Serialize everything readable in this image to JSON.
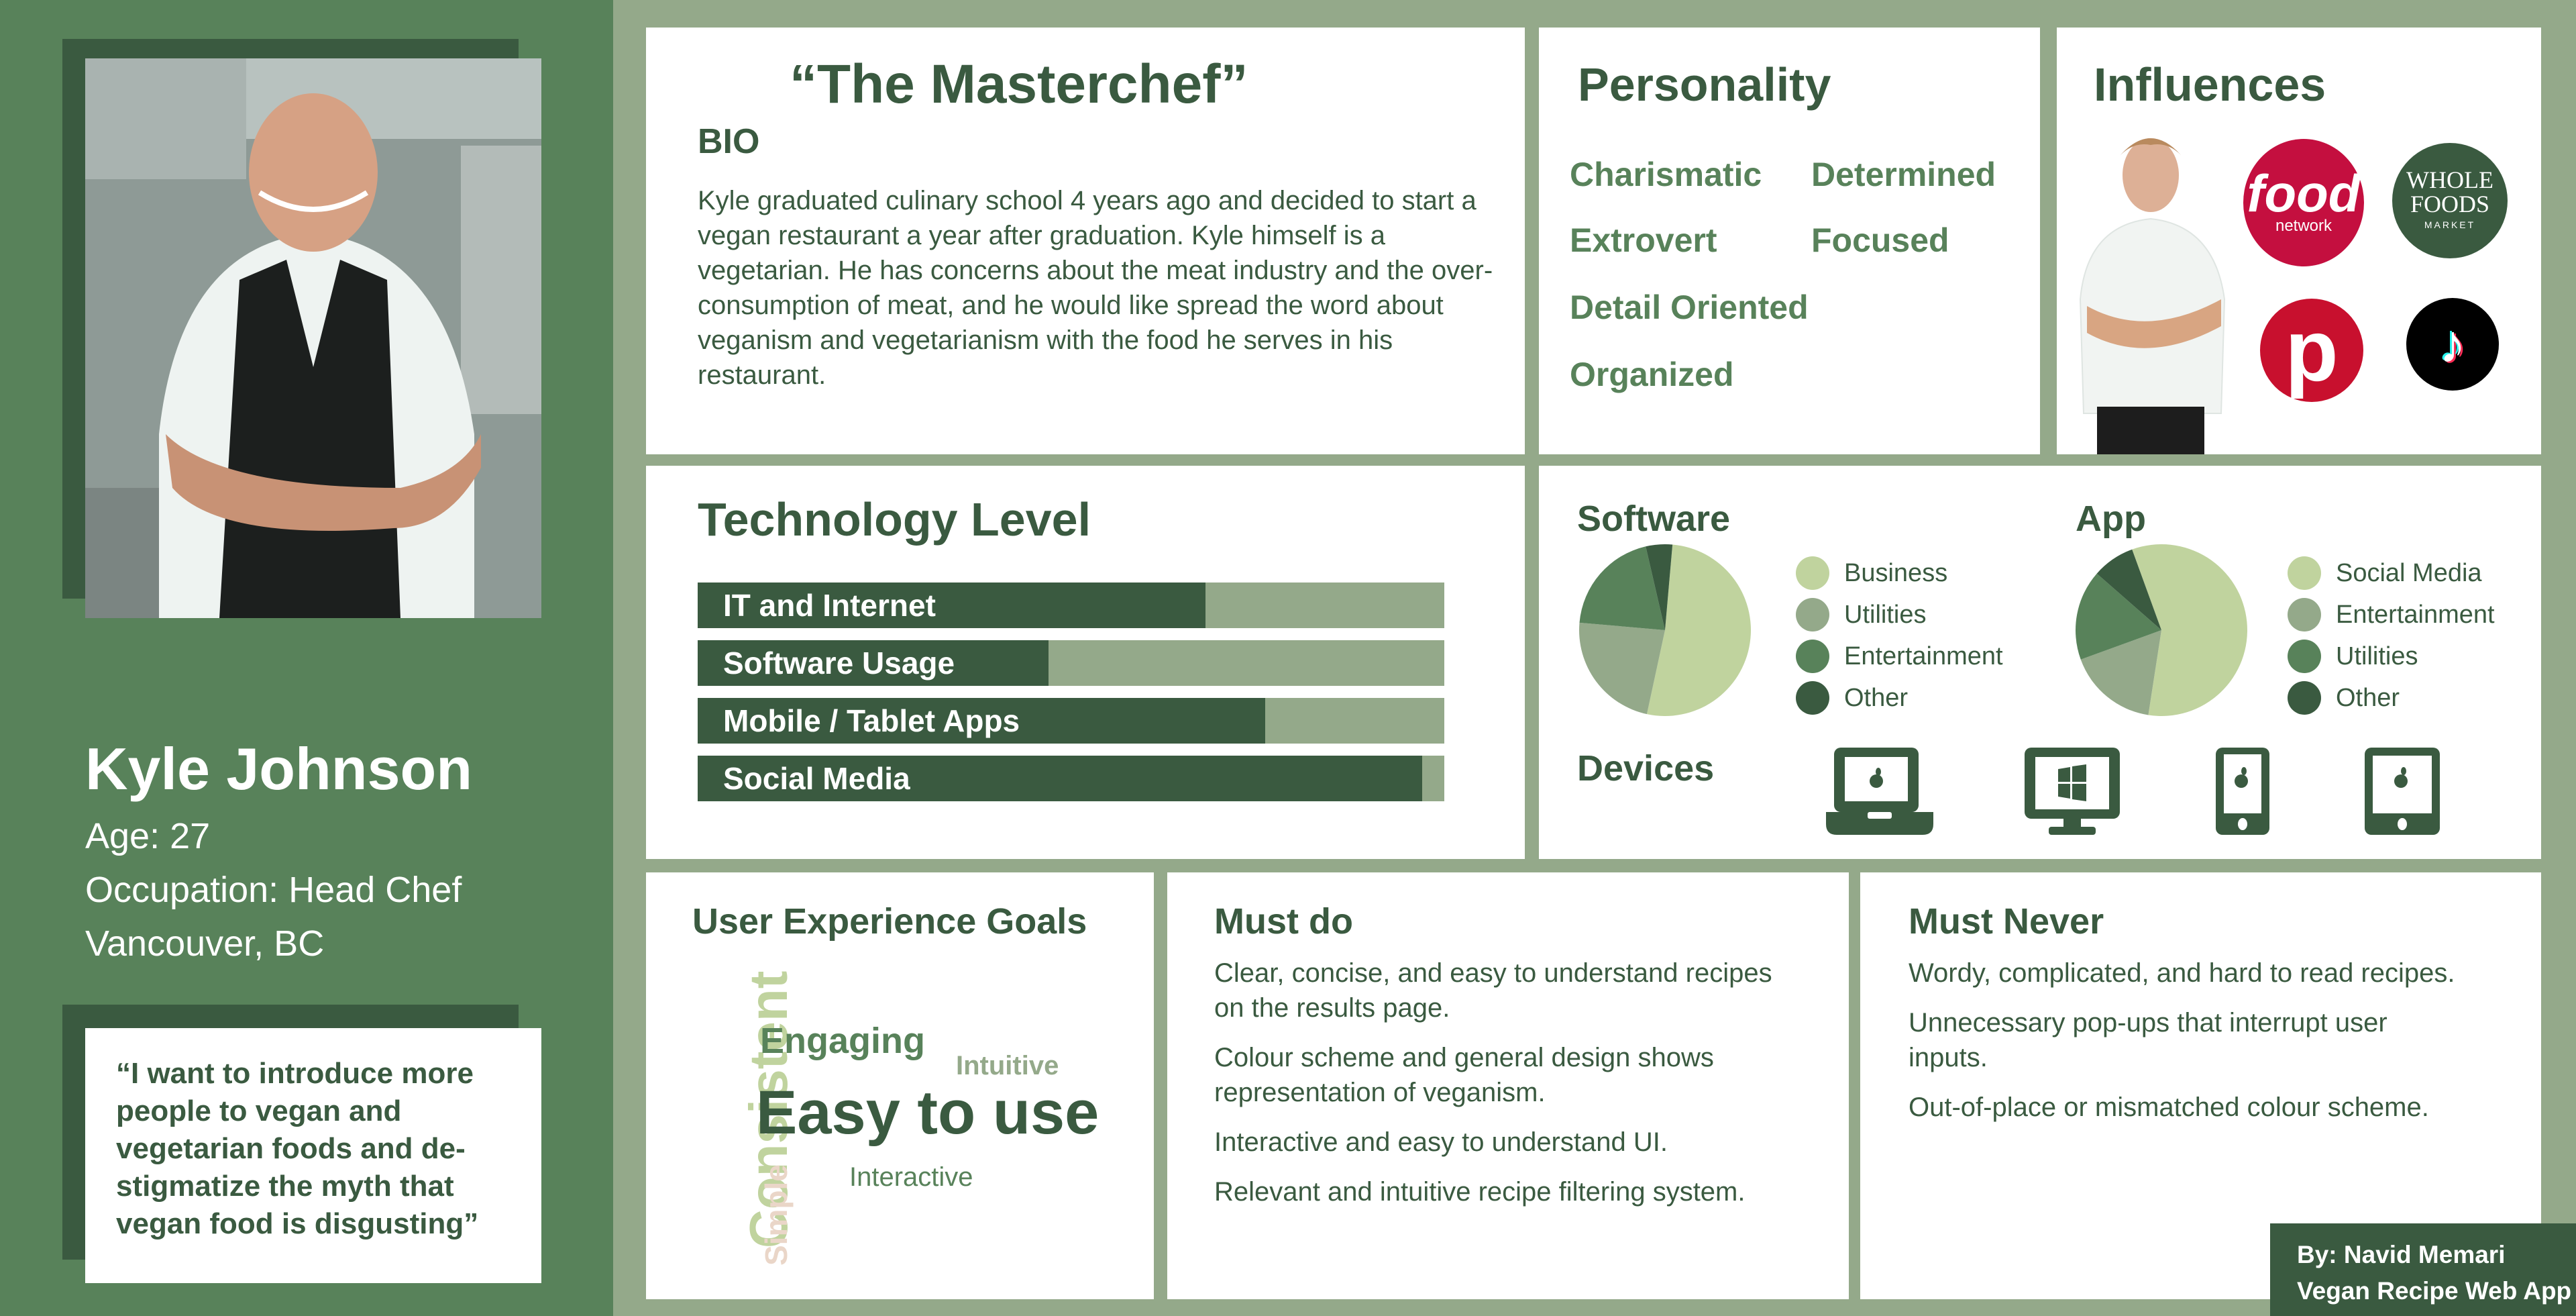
{
  "colors": {
    "dark_green": "#3a5a40",
    "mid_green": "#58825a",
    "sage": "#94a98a",
    "light_green": "#c0d39e",
    "beige": "#ead6c8",
    "white": "#ffffff"
  },
  "profile": {
    "photo_alt": "Smiling chef with crossed tattooed arms in a kitchen",
    "name": "Kyle Johnson",
    "age": "Age: 27",
    "occupation": "Occupation: Head Chef",
    "location": "Vancouver, BC",
    "quote": "“I want to introduce more people to vegan and vegetarian foods and de-stigmatize the myth that vegan food is disgusting”"
  },
  "bio": {
    "title": "“The Masterchef”",
    "heading": "BIO",
    "text": "Kyle graduated culinary school 4 years ago and decided to start a vegan restaurant a year after graduation. Kyle himself is a vegetarian. He has concerns about the meat industry and the over-consumption of meat, and he would like spread the word about veganism and vegetarianism with the food he serves in his restaurant."
  },
  "personality": {
    "title": "Personality",
    "traits": [
      "Charismatic",
      "Determined",
      "Extrovert",
      "Focused",
      "Detail Oriented",
      "Organized"
    ]
  },
  "influences": {
    "title": "Influences",
    "items": [
      {
        "name": "Celebrity chef",
        "icon": "chef-photo"
      },
      {
        "name": "Food Network",
        "icon": "food-network-logo",
        "line1": "food",
        "line2": "network"
      },
      {
        "name": "Whole Foods Market",
        "icon": "whole-foods-logo",
        "line1": "WHOLE",
        "line2": "FOODS",
        "line3": "MARKET"
      },
      {
        "name": "Pinterest",
        "icon": "pinterest-logo",
        "glyph": "p"
      },
      {
        "name": "TikTok",
        "icon": "tiktok-logo",
        "glyph": "♪"
      }
    ]
  },
  "technology": {
    "title": "Technology Level",
    "levels": [
      {
        "label": "IT and Internet",
        "value": 0.68
      },
      {
        "label": "Software Usage",
        "value": 0.47
      },
      {
        "label": "Mobile / Tablet Apps",
        "value": 0.76
      },
      {
        "label": "Social Media",
        "value": 0.97
      }
    ]
  },
  "chart_data": [
    {
      "type": "pie",
      "title": "Software",
      "categories": [
        "Business",
        "Utilities",
        "Entertainment",
        "Other"
      ],
      "values": [
        52,
        23,
        20,
        5
      ],
      "colors": [
        "#c0d39e",
        "#94a98a",
        "#58825a",
        "#3a5a40"
      ],
      "legend": "right"
    },
    {
      "type": "pie",
      "title": "App",
      "categories": [
        "Social Media",
        "Entertainment",
        "Utilities",
        "Other"
      ],
      "values": [
        58,
        17,
        17,
        8
      ],
      "colors": [
        "#c0d39e",
        "#94a98a",
        "#58825a",
        "#3a5a40"
      ],
      "legend": "right"
    }
  ],
  "devices": {
    "title": "Devices",
    "items": [
      {
        "name": "MacBook laptop",
        "icon": "laptop-apple-icon"
      },
      {
        "name": "Windows desktop",
        "icon": "desktop-windows-icon"
      },
      {
        "name": "iPhone",
        "icon": "phone-apple-icon"
      },
      {
        "name": "iPad",
        "icon": "tablet-apple-icon"
      }
    ]
  },
  "ux_goals": {
    "title": "User Experience Goals",
    "words": [
      {
        "text": "Consistent",
        "weight": "large",
        "orientation": "vertical"
      },
      {
        "text": "Engaging",
        "weight": "medium",
        "orientation": "horizontal"
      },
      {
        "text": "Intuitive",
        "weight": "small",
        "orientation": "horizontal"
      },
      {
        "text": "Easy to use",
        "weight": "largest",
        "orientation": "horizontal"
      },
      {
        "text": "Simple",
        "weight": "small",
        "orientation": "vertical"
      },
      {
        "text": "Interactive",
        "weight": "small",
        "orientation": "horizontal"
      }
    ]
  },
  "must_do": {
    "title": "Must do",
    "items": [
      "Clear, concise, and easy to understand recipes on the results page.",
      "Colour scheme and general design shows representation of veganism.",
      "Interactive and easy to understand UI.",
      "Relevant and intuitive recipe filtering system."
    ]
  },
  "must_never": {
    "title": "Must Never",
    "items": [
      "Wordy, complicated, and hard to read recipes.",
      "Unnecessary pop-ups that interrupt user inputs.",
      "Out-of-place or mismatched colour scheme."
    ]
  },
  "credit": {
    "author": "By: Navid Memari",
    "project": "Vegan Recipe Web App"
  }
}
